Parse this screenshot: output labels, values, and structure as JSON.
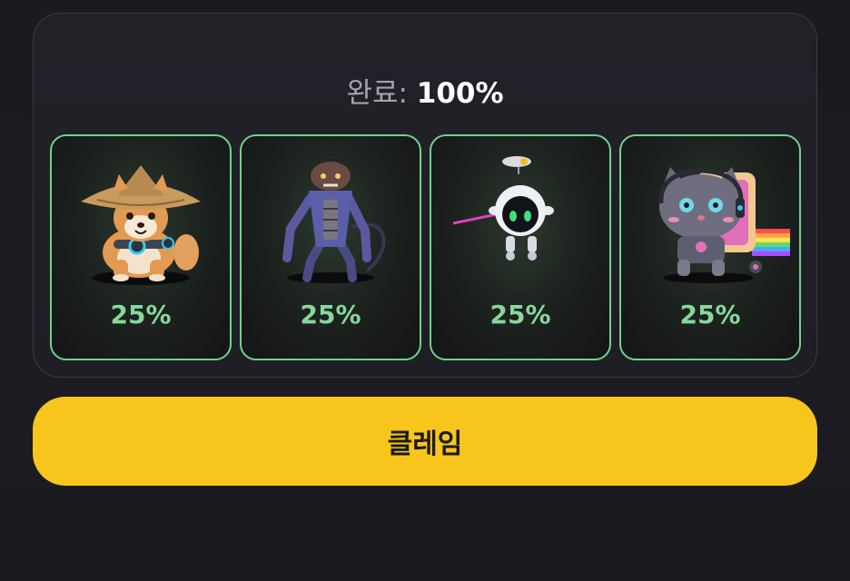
{
  "completion": {
    "label": "완료:",
    "value": "100%"
  },
  "cards": [
    {
      "icon": "shiba-dog-hat-icon",
      "percent": "25%"
    },
    {
      "icon": "robot-rat-icon",
      "percent": "25%"
    },
    {
      "icon": "robot-orb-icon",
      "percent": "25%"
    },
    {
      "icon": "nyan-robot-cat-icon",
      "percent": "25%"
    }
  ],
  "claim_button": {
    "label": "클레임"
  },
  "colors": {
    "accent": "#f7c51c",
    "card_border": "#6fd38a",
    "percent_text": "#86d89a"
  }
}
